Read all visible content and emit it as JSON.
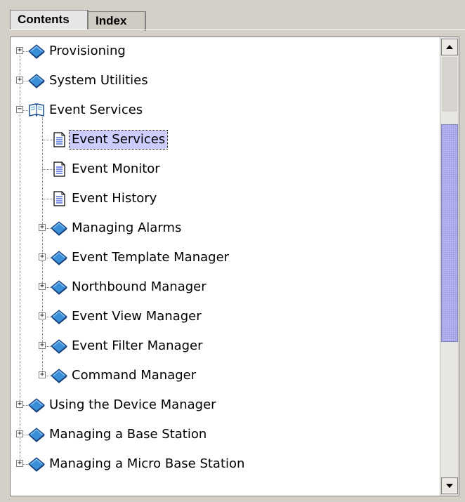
{
  "tabs": [
    {
      "label": "Contents",
      "selected": true
    },
    {
      "label": "Index",
      "selected": false
    }
  ],
  "tree": {
    "rows": [
      {
        "label": "Provisioning",
        "level": 0,
        "type": "book",
        "expanded": false
      },
      {
        "label": "System Utilities",
        "level": 0,
        "type": "book",
        "expanded": false
      },
      {
        "label": "Event Services",
        "level": 0,
        "type": "book-open",
        "expanded": true
      },
      {
        "label": "Event Services",
        "level": 1,
        "type": "page",
        "selected": true
      },
      {
        "label": "Event Monitor",
        "level": 1,
        "type": "page"
      },
      {
        "label": "Event History",
        "level": 1,
        "type": "page"
      },
      {
        "label": "Managing Alarms",
        "level": 1,
        "type": "book",
        "expanded": false
      },
      {
        "label": "Event Template Manager",
        "level": 1,
        "type": "book",
        "expanded": false
      },
      {
        "label": "Northbound Manager",
        "level": 1,
        "type": "book",
        "expanded": false
      },
      {
        "label": "Event View Manager",
        "level": 1,
        "type": "book",
        "expanded": false
      },
      {
        "label": "Event Filter Manager",
        "level": 1,
        "type": "book",
        "expanded": false
      },
      {
        "label": "Command Manager",
        "level": 1,
        "type": "book",
        "expanded": false
      },
      {
        "label": "Using the Device Manager",
        "level": 0,
        "type": "book",
        "expanded": false
      },
      {
        "label": "Managing a Base Station",
        "level": 0,
        "type": "book",
        "expanded": false
      },
      {
        "label": "Managing a Micro Base Station",
        "level": 0,
        "type": "book",
        "expanded": false
      }
    ]
  },
  "scrollbar": {
    "position_fraction": 0.16,
    "visible_fraction": 0.52
  },
  "icons": {
    "book": "closed-book-icon",
    "book-open": "open-book-icon",
    "page": "document-page-icon"
  },
  "colors": {
    "selection": "#ccccff",
    "thumb": "#b4b4f0",
    "book": "#3a8fd8"
  }
}
